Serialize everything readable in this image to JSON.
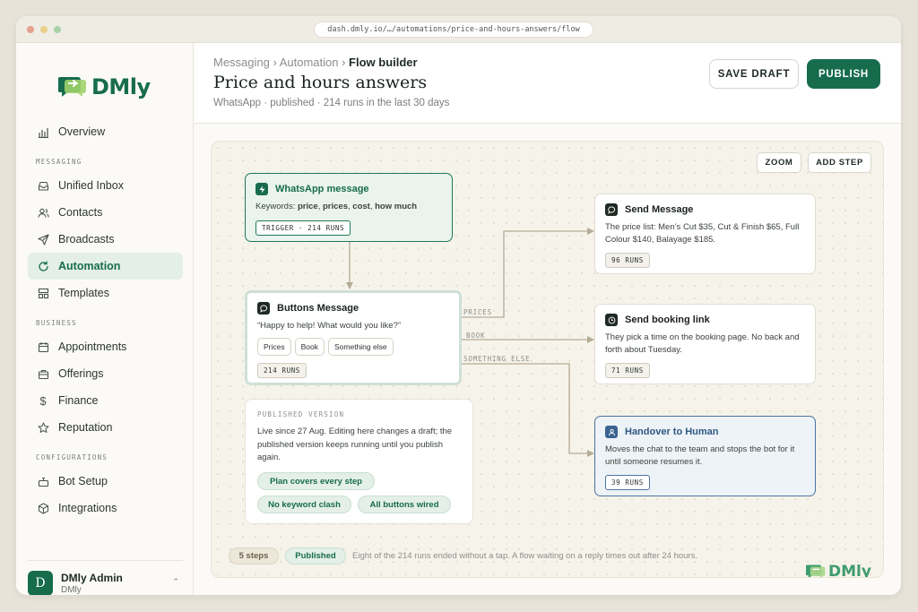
{
  "browser": {
    "url": "dash.dmly.io/…/automations/price-and-hours-answers/flow",
    "dot_colors": [
      "#e6a08f",
      "#ecd08a",
      "#a9d2a9"
    ]
  },
  "brand": {
    "name": "DMly",
    "accent": "#176c4e"
  },
  "sidebar": {
    "overview": "Overview",
    "sections": {
      "messaging": "MESSAGING",
      "business": "BUSINESS",
      "configurations": "CONFIGURATIONS"
    },
    "items": {
      "unified_inbox": "Unified Inbox",
      "contacts": "Contacts",
      "broadcasts": "Broadcasts",
      "automation": "Automation",
      "templates": "Templates",
      "appointments": "Appointments",
      "offerings": "Offerings",
      "finance": "Finance",
      "reputation": "Reputation",
      "bot_setup": "Bot Setup",
      "integrations": "Integrations"
    },
    "user": {
      "initial": "D",
      "name": "DMly Admin",
      "org": "DMly"
    }
  },
  "header": {
    "breadcrumb": [
      "Messaging ›",
      "Automation ›",
      "Flow builder"
    ],
    "title": "Price and hours answers",
    "subtitle": "WhatsApp · published · 214 runs in the last 30 days",
    "save_draft": "SAVE DRAFT",
    "publish": "PUBLISH"
  },
  "canvas": {
    "zoom": "ZOOM",
    "add_step": "ADD STEP",
    "wire_labels": {
      "prices": "PRICES",
      "book": "BOOK",
      "something_else": "SOMETHING ELSE"
    },
    "trigger": {
      "title": "WhatsApp message",
      "keywords_prefix": "Keywords:",
      "keywords": [
        "price",
        "prices",
        "cost",
        "how much"
      ],
      "tag": "TRIGGER · 214 RUNS"
    },
    "buttons_message": {
      "title": "Buttons Message",
      "text": "“Happy to help! What would you like?”",
      "buttons": [
        "Prices",
        "Book",
        "Something else"
      ],
      "runs": "214 RUNS"
    },
    "send_message": {
      "title": "Send Message",
      "text": "The price list: Men’s Cut $35, Cut & Finish $65, Full Colour $140, Balayage $185.",
      "runs": "96 RUNS"
    },
    "send_booking": {
      "title": "Send booking link",
      "text": "They pick a time on the booking page. No back and forth about Tuesday.",
      "runs": "71 RUNS"
    },
    "handover": {
      "title": "Handover to Human",
      "text": "Moves the chat to the team and stops the bot for it until someone resumes it.",
      "runs": "39 RUNS"
    },
    "published_version": {
      "label": "PUBLISHED VERSION",
      "text": "Live since 27 Aug. Editing here changes a draft; the published version keeps running until you publish again.",
      "checks": [
        "Plan covers every step",
        "No keyword clash",
        "All buttons wired"
      ]
    },
    "footer": {
      "steps": "5 steps",
      "status": "Published",
      "note": "Eight of the 214 runs ended without a tap. A flow waiting on a reply times out after 24 hours."
    },
    "watermark": "DMly"
  }
}
